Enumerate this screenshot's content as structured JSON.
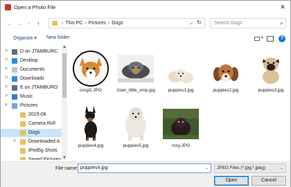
{
  "window": {
    "title": "Open a Photo File",
    "close_glyph": "✕"
  },
  "address": {
    "crumbs": [
      "This PC",
      "Pictures",
      "Dogs"
    ],
    "search_placeholder": "Search Dogs"
  },
  "toolbar": {
    "organize": "Organize ▾",
    "new_folder": "New folder"
  },
  "nav": {
    "items": [
      {
        "label": "D on JTAMBURC",
        "icon": "drive-icon",
        "chevron": ">"
      },
      {
        "label": "Desktop",
        "icon": "desktop-icon",
        "chevron": ">"
      },
      {
        "label": "Documents",
        "icon": "documents-icon",
        "chevron": ">"
      },
      {
        "label": "Downloads",
        "icon": "downloads-icon",
        "chevron": ">"
      },
      {
        "label": "E on JTAMBURO",
        "icon": "drive-icon",
        "chevron": ">"
      },
      {
        "label": "Music",
        "icon": "music-icon",
        "chevron": ">"
      },
      {
        "label": "Pictures",
        "icon": "pictures-icon",
        "chevron": "v"
      },
      {
        "label": "2015-08",
        "icon": "folder-icon",
        "chevron": ""
      },
      {
        "label": "Camera Roll",
        "icon": "folder-icon",
        "chevron": ""
      },
      {
        "label": "Dogs",
        "icon": "folder-icon",
        "chevron": "",
        "selected": true
      },
      {
        "label": "Downloaded A",
        "icon": "folder-icon",
        "chevron": ">"
      },
      {
        "label": "iPed5g Shots",
        "icon": "folder-icon",
        "chevron": ""
      },
      {
        "label": "Saved Pictures",
        "icon": "folder-icon",
        "chevron": ""
      }
    ]
  },
  "files": [
    {
      "name": "corgi1.JPG",
      "icon": "corgi-photo-icon"
    },
    {
      "name": "Joan_little_smp.jpg",
      "icon": "yorkie-photo-icon"
    },
    {
      "name": "puppies1.jpg",
      "icon": "puppies-photo-icon"
    },
    {
      "name": "puppies2.jpg",
      "icon": "beagle-photo-icon"
    },
    {
      "name": "puppies3.jpg",
      "icon": "pug-photo-icon"
    },
    {
      "name": "puppies4.jpg",
      "icon": "doberman-photo-icon"
    },
    {
      "name": "puppies5.jpg",
      "icon": "poodle-photo-icon"
    },
    {
      "name": "roxy.JPG",
      "icon": "dog-outdoor-photo-icon"
    }
  ],
  "bottom": {
    "file_name_label": "File name:",
    "file_name_value": "puppies4.jpg",
    "filter_value": "JPEG Files (*.jpg;*.jpeg)",
    "open_label": "Open",
    "cancel_label": "Cancel"
  },
  "colors": {
    "accent": "#0078d7",
    "selection": "#cce4f7"
  }
}
